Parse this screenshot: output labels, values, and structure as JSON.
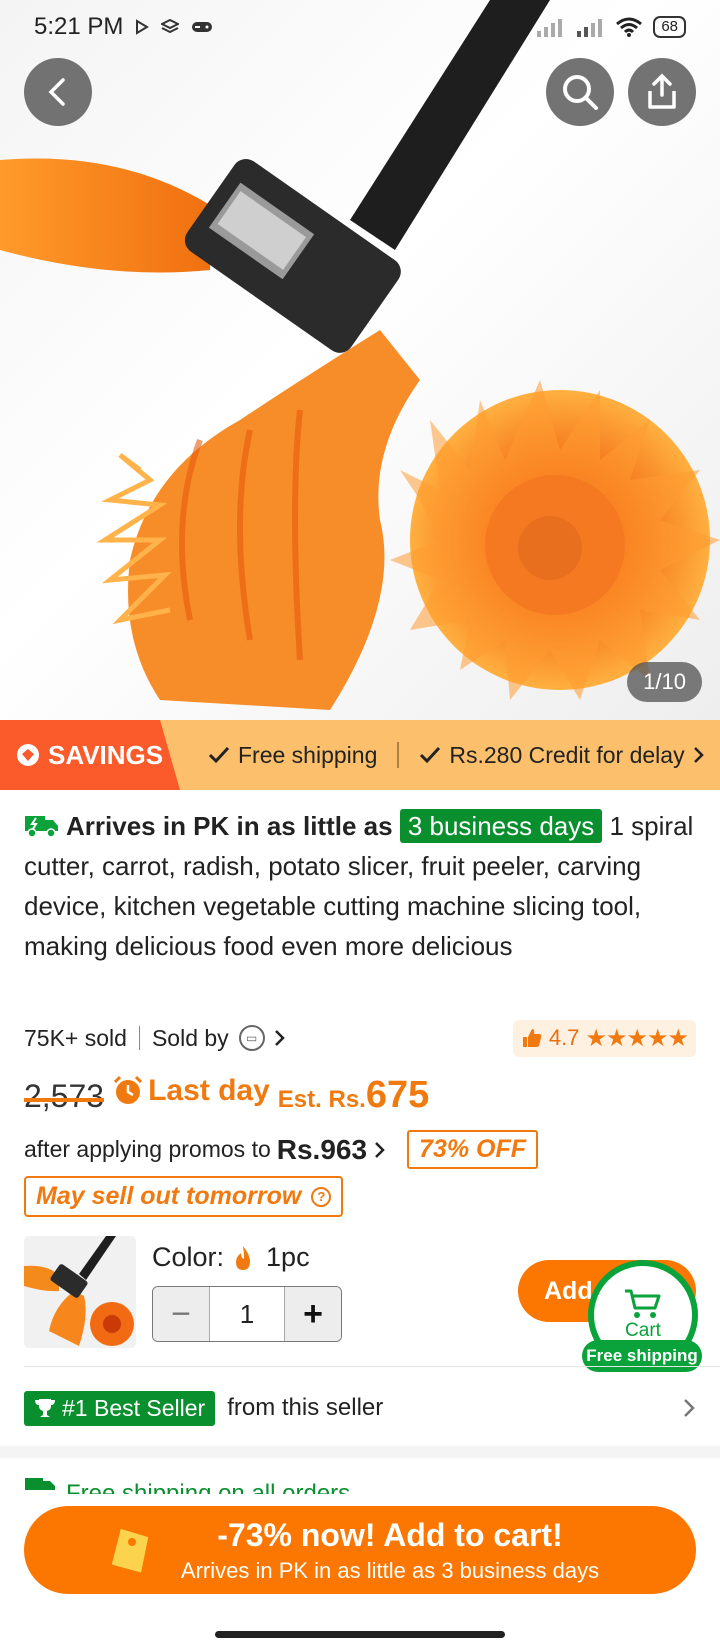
{
  "status_bar": {
    "time": "5:21 PM",
    "battery": "68",
    "icons": [
      "play-icon",
      "layers-icon",
      "gamepad-icon",
      "signal-icon",
      "signal-icon",
      "wifi-icon",
      "battery-icon"
    ]
  },
  "hero": {
    "image_counter": "1/10",
    "back_icon": "chevron-left-icon",
    "search_icon": "search-icon",
    "share_icon": "share-icon"
  },
  "savings_bar": {
    "tag_label": "SAVINGS",
    "perks": [
      "Free shipping",
      "Rs.280 Credit for delay"
    ]
  },
  "product": {
    "arrive_text": "Arrives in PK in as little as",
    "arrive_days": "3 business days",
    "title": "1 spiral cutter, carrot, radish, potato slicer, fruit peeler, carving device, kitchen vegetable cutting machine slicing tool, making delicious food even more delicious",
    "sold": "75K+ sold",
    "sold_by": "Sold by",
    "rating": "4.7",
    "stars": "★★★★★"
  },
  "price": {
    "old_price": "2,573",
    "last_day": "Last day",
    "est_label": "Est. Rs.",
    "est_value": "675",
    "promo_text": "after applying promos to",
    "promo_price": "Rs.963",
    "off_badge": "73% OFF",
    "sellout": "May sell out tomorrow"
  },
  "variant": {
    "color_label": "Color:",
    "color_value": "1pc",
    "quantity": "1",
    "minus": "−",
    "plus": "+",
    "add_button": "Add to cart",
    "cart_label": "Cart",
    "cart_free": "Free shipping"
  },
  "best_seller": {
    "badge": "#1 Best Seller",
    "text": "from this seller"
  },
  "shipping_peek": {
    "text": "Free shipping on all orders"
  },
  "cta": {
    "line1": "-73% now! Add to cart!",
    "line2": "Arrives in PK in as little as 3 business days"
  },
  "colors": {
    "orange": "#fb7701",
    "green": "#0a8f2e",
    "savings_bg": "#fcbf6b",
    "savings_tag": "#fb5a2b"
  }
}
